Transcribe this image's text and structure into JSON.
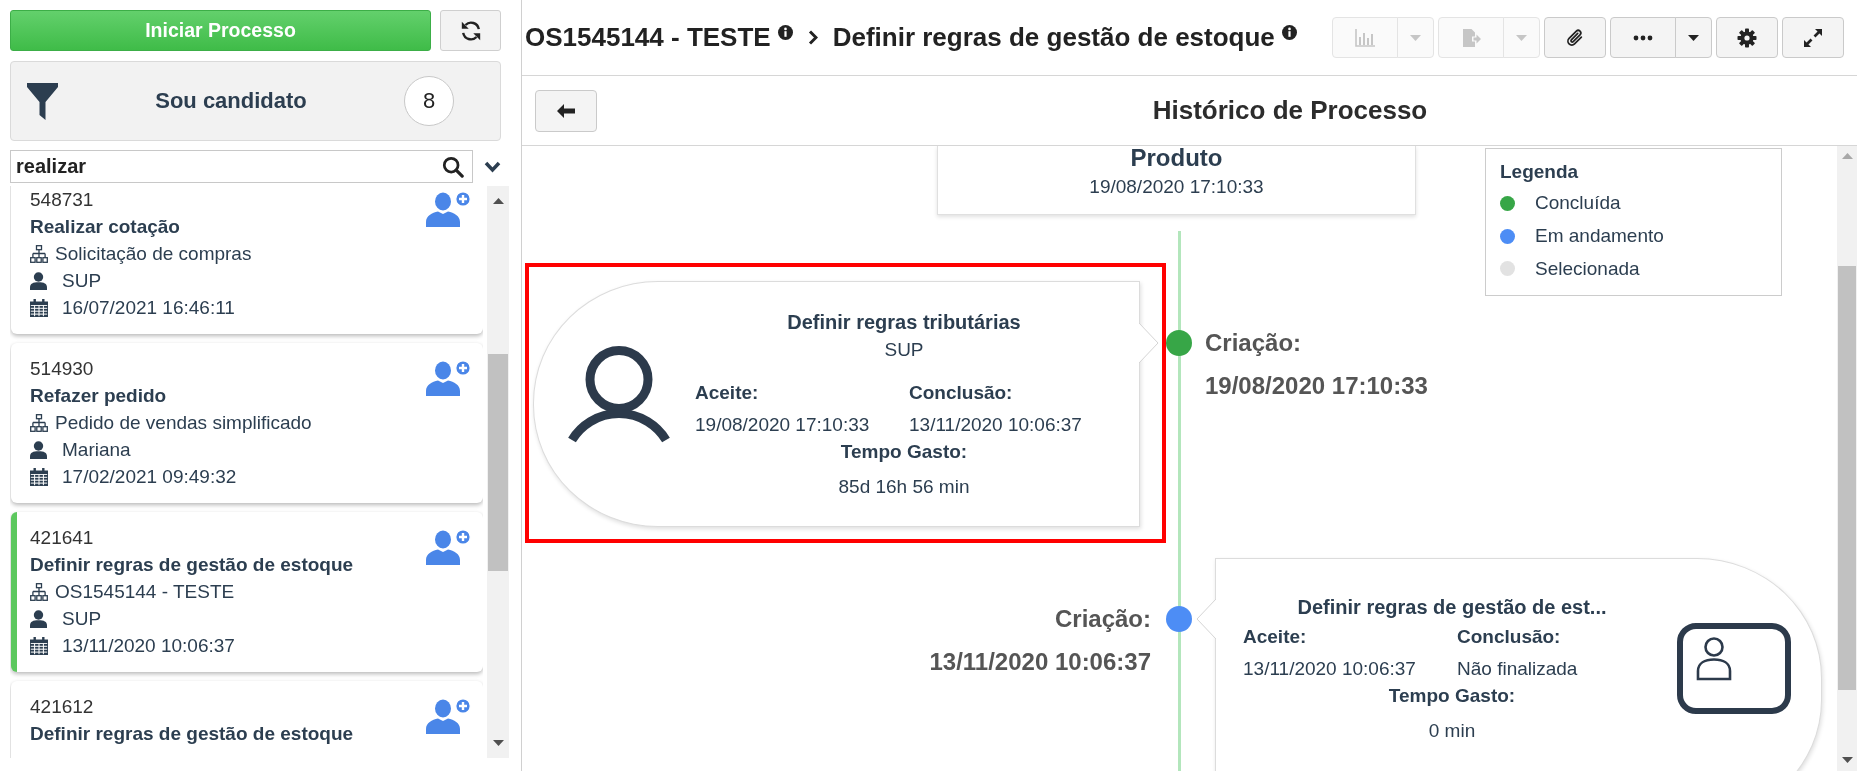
{
  "sidebar": {
    "start_button": "Iniciar Processo",
    "filter": {
      "label": "Sou candidato",
      "count": "8"
    },
    "search": {
      "value": "realizar"
    },
    "tasks": [
      {
        "id": "548731",
        "title": "Realizar cotação",
        "process": "Solicitação de compras",
        "user": "SUP",
        "date": "16/07/2021 16:46:11",
        "selected": false
      },
      {
        "id": "514930",
        "title": "Refazer pedido",
        "process": "Pedido de vendas simplificado",
        "user": "Mariana",
        "date": "17/02/2021 09:49:32",
        "selected": false
      },
      {
        "id": "421641",
        "title": "Definir regras de gestão de estoque",
        "process": "OS1545144 - TESTE",
        "user": "SUP",
        "date": "13/11/2020 10:06:37",
        "selected": true
      },
      {
        "id": "421612",
        "title": "Definir regras de gestão de estoque",
        "selected": false
      }
    ]
  },
  "header": {
    "breadcrumb": [
      {
        "label": "OS1545144 - TESTE"
      },
      {
        "label": "Definir regras de gestão de estoque"
      }
    ],
    "toolbar": [
      {
        "kind": "chart",
        "disabled": true,
        "menu": true
      },
      {
        "kind": "export",
        "disabled": true,
        "menu": true
      },
      {
        "kind": "attach",
        "disabled": false,
        "menu": false
      },
      {
        "kind": "more",
        "disabled": false,
        "menu": true
      },
      {
        "kind": "settings",
        "disabled": false,
        "menu": false
      },
      {
        "kind": "expand",
        "disabled": false,
        "menu": false
      }
    ]
  },
  "history": {
    "title": "Histórico de Processo",
    "legend": {
      "title": "Legenda",
      "items": [
        {
          "label": "Concluída",
          "color": "#37a647"
        },
        {
          "label": "Em andamento",
          "color": "#4d8df5"
        },
        {
          "label": "Selecionada",
          "color": "#e2e2e2"
        }
      ]
    },
    "events": [
      {
        "kind": "summary",
        "title": "Produto",
        "date": "19/08/2020 17:10:33"
      },
      {
        "kind": "left",
        "highlighted": true,
        "color": "#37a647",
        "title": "Definir regras tributárias",
        "user": "SUP",
        "accept_label": "Aceite:",
        "accept_value": "19/08/2020 17:10:33",
        "conclusion_label": "Conclusão:",
        "conclusion_value": "13/11/2020 10:06:37",
        "time_label": "Tempo Gasto:",
        "time_value": "85d 16h 56 min",
        "created_label": "Criação:",
        "created_value": "19/08/2020 17:10:33"
      },
      {
        "kind": "right",
        "highlighted": false,
        "color": "#4d8df5",
        "title": "Definir regras de gestão de est...",
        "accept_label": "Aceite:",
        "accept_value": "13/11/2020 10:06:37",
        "conclusion_label": "Conclusão:",
        "conclusion_value": "Não finalizada",
        "time_label": "Tempo Gasto:",
        "time_value": "0 min",
        "created_label": "Criação:",
        "created_value": "13/11/2020 10:06:37"
      }
    ]
  }
}
